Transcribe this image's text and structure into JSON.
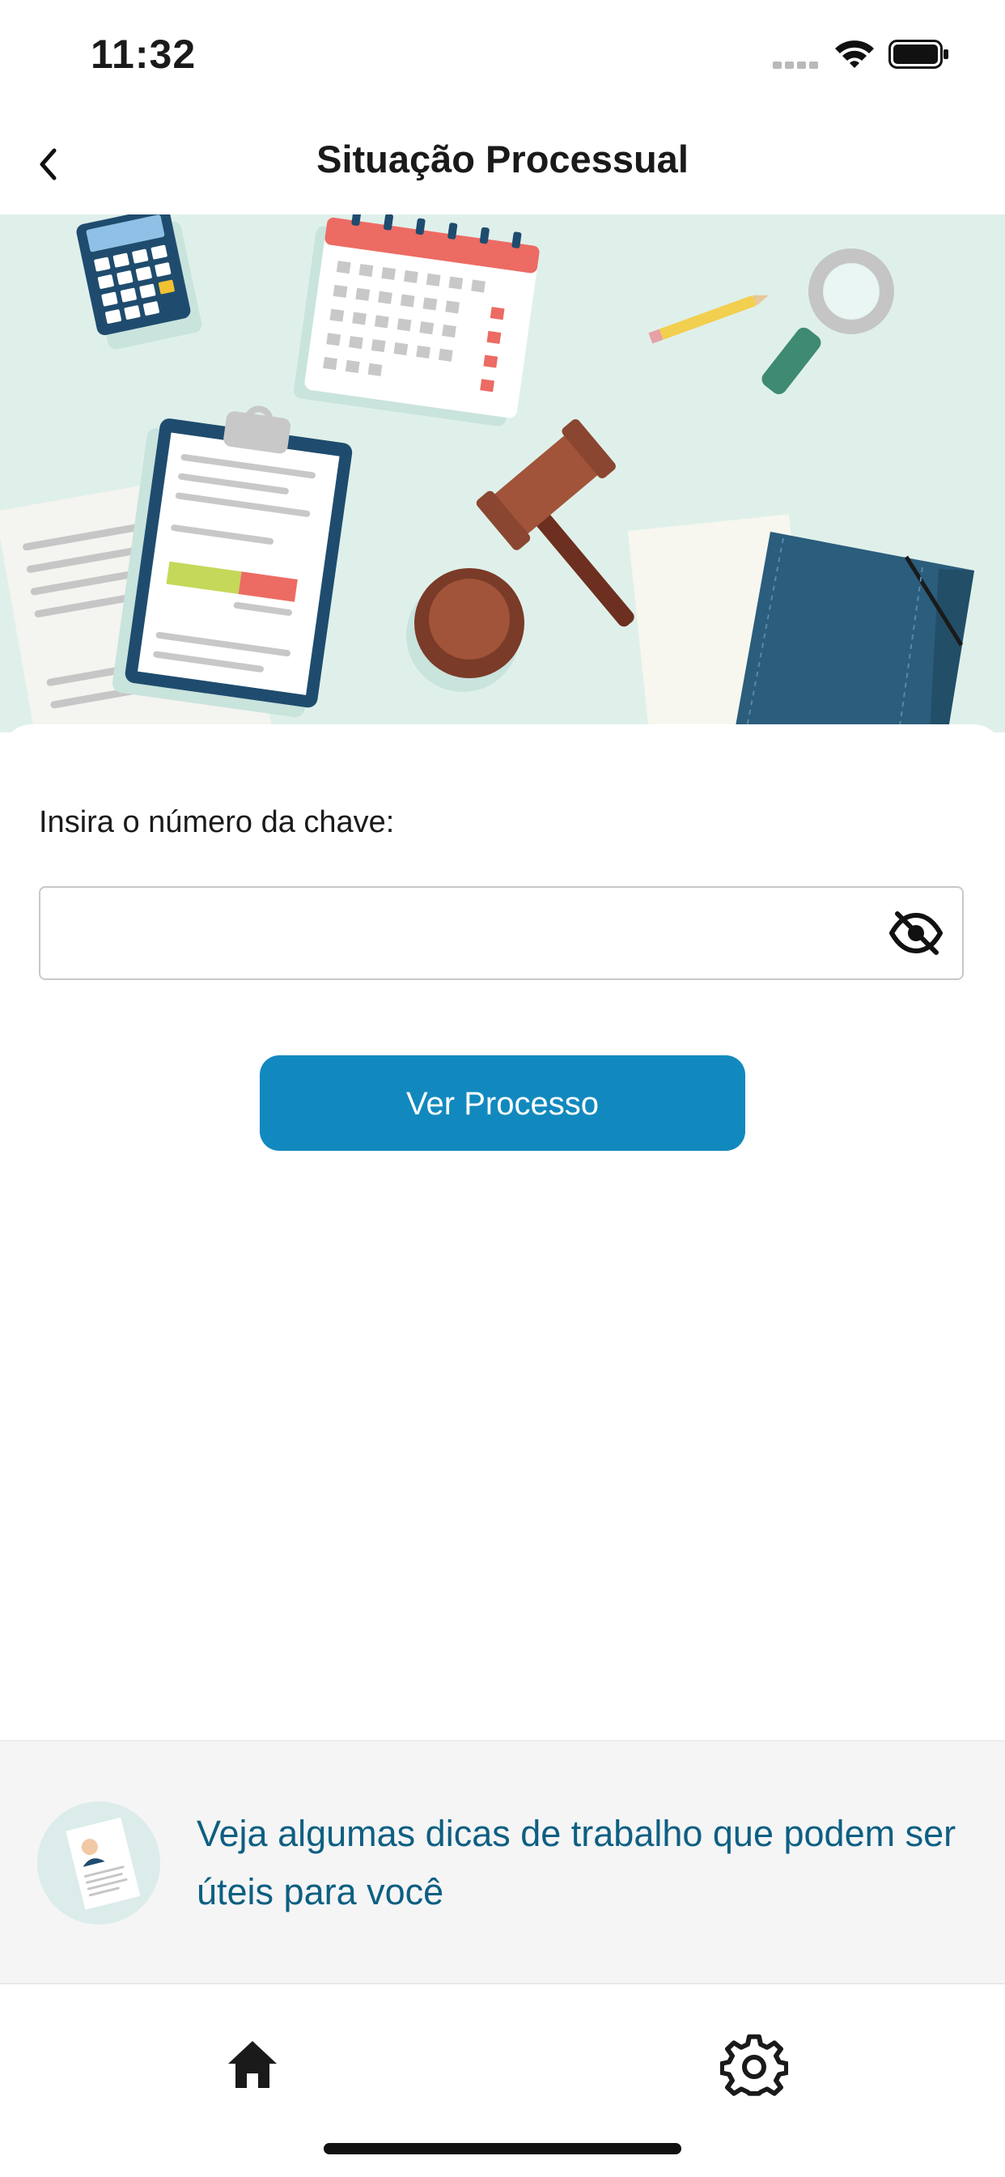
{
  "status_bar": {
    "time": "11:32",
    "icons": [
      "cellular-signal-icon",
      "wifi-icon",
      "battery-icon"
    ]
  },
  "header": {
    "back_icon": "chevron-left-icon",
    "title": "Situação Processual"
  },
  "hero": {
    "illustration": "legal-desk-illustration"
  },
  "form": {
    "key_label": "Insira o número da chave:",
    "key_value": "",
    "key_placeholder": "",
    "visibility_icon": "eye-off-icon",
    "submit_label": "Ver Processo"
  },
  "tips": {
    "illustration": "resume-document-icon",
    "text": "Veja algumas dicas de trabalho que podem ser úteis para você"
  },
  "tab_bar": {
    "items": [
      {
        "icon": "home-icon"
      },
      {
        "icon": "gear-icon"
      }
    ]
  },
  "colors": {
    "primary": "#1289be",
    "tips_text": "#0d5f82",
    "hero_background": "#dff0ea",
    "tips_background": "#f5f5f5"
  }
}
